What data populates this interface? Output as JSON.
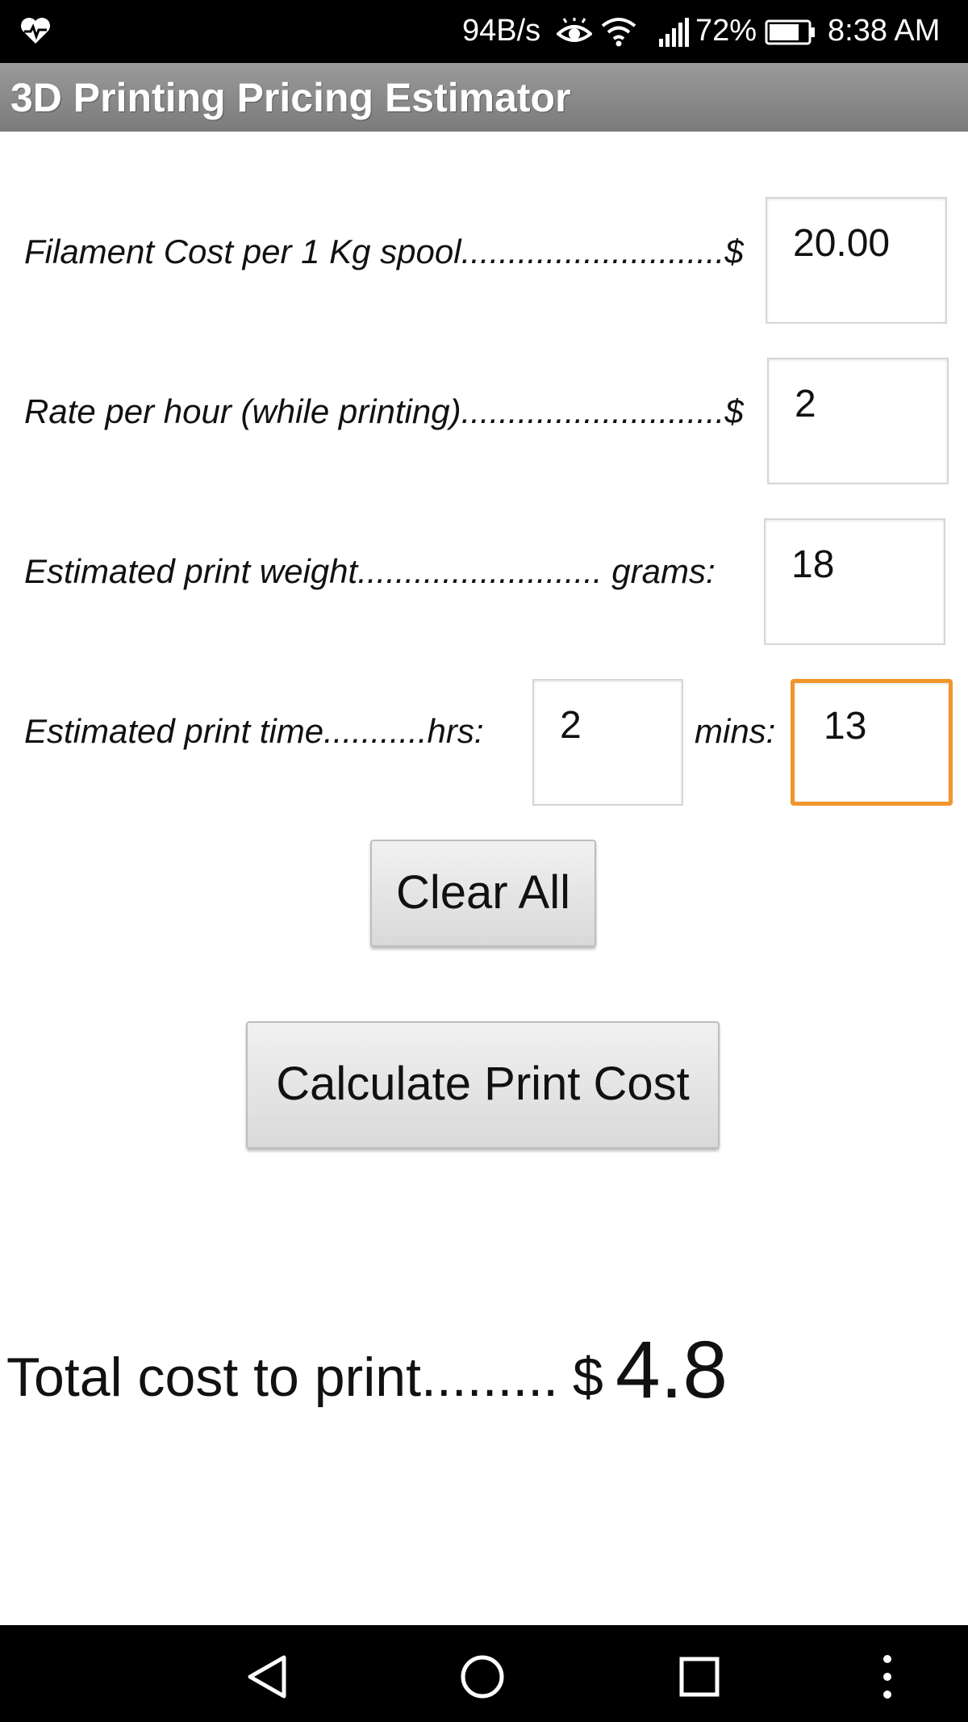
{
  "status_bar": {
    "network_speed": "94B/s",
    "battery_percent": "72%",
    "time": "8:38 AM",
    "icons": [
      "heart-monitor-icon",
      "eye-icon",
      "wifi-icon",
      "signal-icon",
      "battery-icon"
    ]
  },
  "app_bar": {
    "title": "3D Printing Pricing Estimator"
  },
  "form": {
    "filament": {
      "label": "Filament Cost per 1 Kg spool............................$",
      "value": "20.00"
    },
    "rate": {
      "label": "Rate per hour (while printing)............................$",
      "value": "2"
    },
    "weight": {
      "label": "Estimated print weight.......................... grams:",
      "value": "18"
    },
    "time": {
      "label": "Estimated print time...........hrs:",
      "hours_value": "2",
      "mins_label": "mins:",
      "mins_value": "13"
    }
  },
  "buttons": {
    "clear_all": "Clear All",
    "calculate": "Calculate Print Cost"
  },
  "result": {
    "label": "Total cost to print.........",
    "currency": "$",
    "value": "4.8"
  },
  "nav_bar": {
    "icons": [
      "back-icon",
      "home-icon",
      "recents-icon",
      "more-icon"
    ]
  },
  "colors": {
    "focus": "#f0962b",
    "app_bar": "#8a8a8a"
  }
}
